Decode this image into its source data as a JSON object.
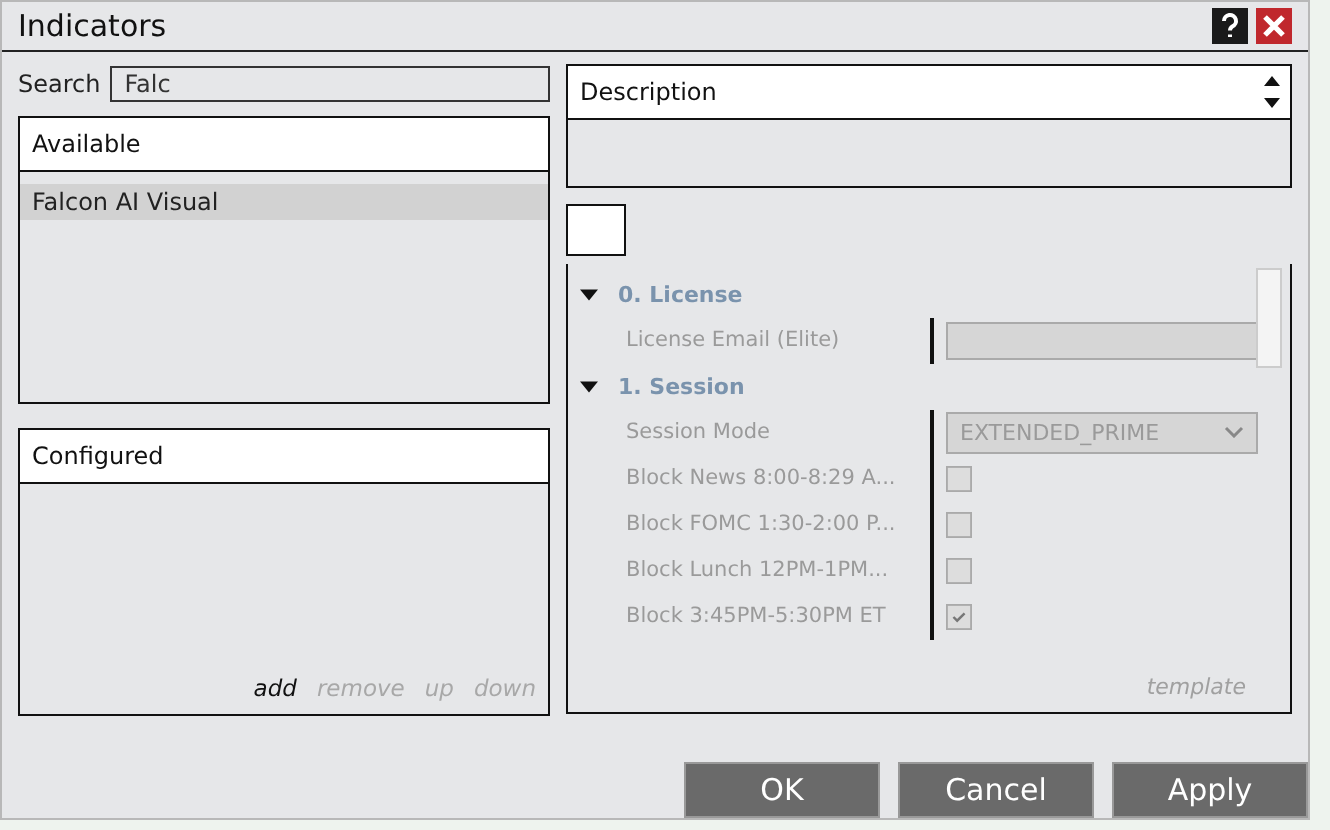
{
  "window": {
    "title": "Indicators"
  },
  "search": {
    "label": "Search",
    "value": "Falc"
  },
  "available": {
    "header": "Available",
    "items": [
      {
        "label": "Falcon AI Visual",
        "selected": true
      }
    ]
  },
  "configured": {
    "header": "Configured",
    "actions": [
      {
        "label": "add",
        "disabled": false
      },
      {
        "label": "remove",
        "disabled": true
      },
      {
        "label": "up",
        "disabled": true
      },
      {
        "label": "down",
        "disabled": true
      }
    ]
  },
  "description": {
    "header": "Description"
  },
  "properties": {
    "rows": [
      {
        "kind": "category",
        "label": "0. License",
        "expanded": true
      },
      {
        "kind": "text",
        "label": "License Email (Elite)"
      },
      {
        "kind": "category",
        "label": "1. Session",
        "expanded": true
      },
      {
        "kind": "select",
        "label": "Session Mode",
        "value": "EXTENDED_PRIME"
      },
      {
        "kind": "checkbox",
        "label": "Block News 8:00-8:29 A...",
        "checked": false
      },
      {
        "kind": "checkbox",
        "label": "Block FOMC 1:30-2:00 P...",
        "checked": false
      },
      {
        "kind": "checkbox",
        "label": "Block Lunch 12PM-1PM...",
        "checked": false
      },
      {
        "kind": "checkbox",
        "label": "Block 3:45PM-5:30PM ET",
        "checked": true
      }
    ],
    "template": "template"
  },
  "buttons": [
    "OK",
    "Cancel",
    "Apply"
  ]
}
